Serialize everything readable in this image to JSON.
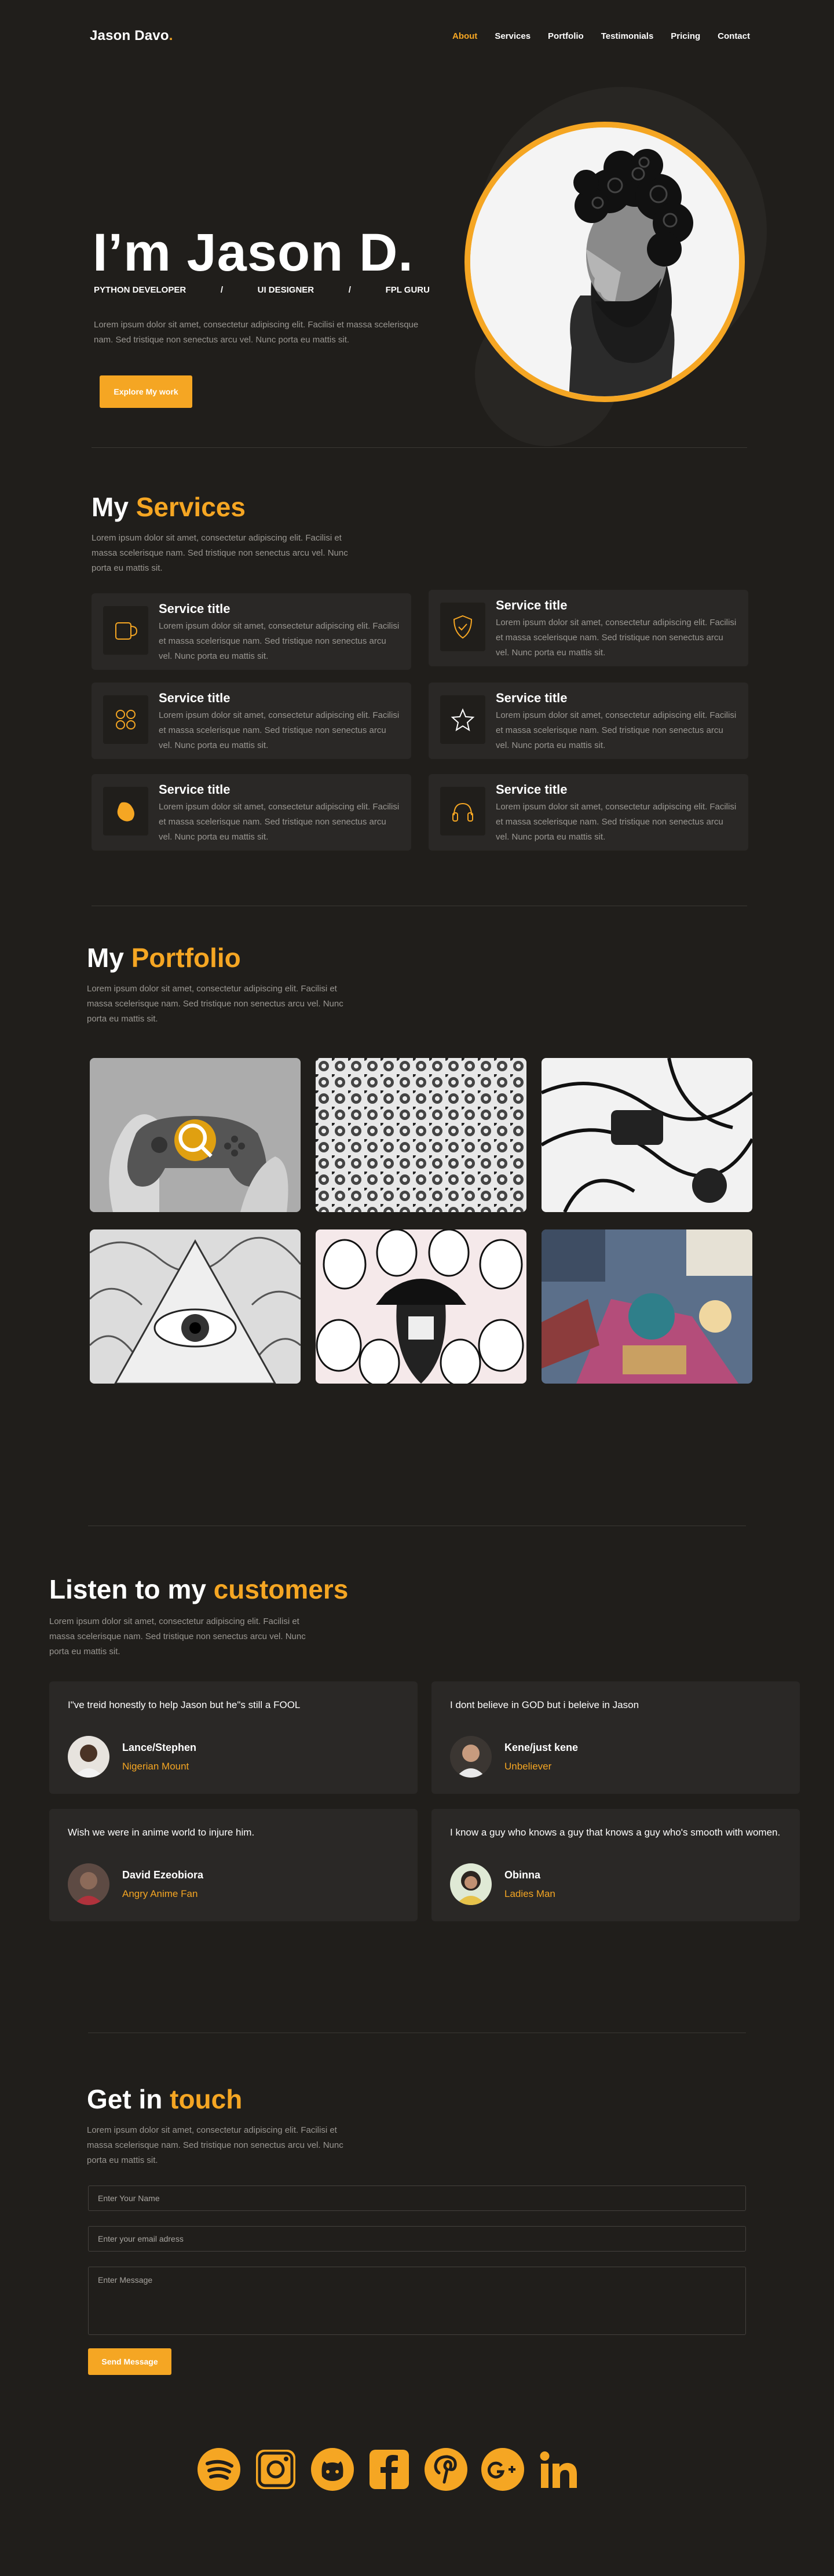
{
  "nav": {
    "brand": "Jason Davo",
    "brand_dot": ".",
    "items": [
      {
        "label": "About",
        "active": true
      },
      {
        "label": "Services",
        "active": false
      },
      {
        "label": "Portfolio",
        "active": false
      },
      {
        "label": "Testimonials",
        "active": false
      },
      {
        "label": "Pricing",
        "active": false
      },
      {
        "label": "Contact",
        "active": false
      }
    ]
  },
  "hero": {
    "title": "I’m Jason D.",
    "roles": [
      "PYTHON DEVELOPER",
      "/",
      "UI DESIGNER",
      "/",
      "FPL GURU"
    ],
    "text": "Lorem ipsum dolor sit amet, consectetur adipiscing elit. Facilisi et massa scelerisque nam. Sed tristique non senectus arcu vel. Nunc porta eu mattis sit.",
    "button": "Explore My work"
  },
  "services": {
    "title_plain": "My ",
    "title_accent": "Services",
    "text": "Lorem ipsum dolor sit amet, consectetur adipiscing elit. Facilisi et massa scelerisque nam. Sed tristique non senectus arcu vel. Nunc porta eu mattis sit.",
    "cards": [
      {
        "title": "Service title",
        "text": "Lorem ipsum dolor sit amet, consectetur adipiscing elit. Facilisi et massa scelerisque nam. Sed tristique non senectus arcu vel. Nunc porta eu mattis sit.",
        "icon": "mug-icon"
      },
      {
        "title": "Service title",
        "text": "Lorem ipsum dolor sit amet, consectetur adipiscing elit. Facilisi et massa scelerisque nam. Sed tristique non senectus arcu vel. Nunc porta eu mattis sit.",
        "icon": "shield-check-icon"
      },
      {
        "title": "Service title",
        "text": "Lorem ipsum dolor sit amet, consectetur adipiscing elit. Facilisi et massa scelerisque nam. Sed tristique non senectus arcu vel. Nunc porta eu mattis sit.",
        "icon": "grid-circles-icon"
      },
      {
        "title": "Service title",
        "text": "Lorem ipsum dolor sit amet, consectetur adipiscing elit. Facilisi et massa scelerisque nam. Sed tristique non senectus arcu vel. Nunc porta eu mattis sit.",
        "icon": "star-icon"
      },
      {
        "title": "Service title",
        "text": "Lorem ipsum dolor sit amet, consectetur adipiscing elit. Facilisi et massa scelerisque nam. Sed tristique non senectus arcu vel. Nunc porta eu mattis sit.",
        "icon": "blob-icon"
      },
      {
        "title": "Service title",
        "text": "Lorem ipsum dolor sit amet, consectetur adipiscing elit. Facilisi et massa scelerisque nam. Sed tristique non senectus arcu vel. Nunc porta eu mattis sit.",
        "icon": "headphones-icon"
      }
    ]
  },
  "portfolio": {
    "title_plain": "My ",
    "title_accent": "Portfolio",
    "text": "Lorem ipsum dolor sit amet, consectetur adipiscing elit. Facilisi et massa scelerisque nam. Sed tristique non senectus arcu vel. Nunc porta eu mattis sit."
  },
  "testimonials": {
    "title_plain": "Listen to my ",
    "title_accent": "customers",
    "text": "Lorem ipsum dolor sit amet, consectetur adipiscing elit. Facilisi et massa scelerisque nam. Sed tristique non senectus arcu vel. Nunc porta eu mattis sit.",
    "items": [
      {
        "quote": "I\"ve treid honestly to help Jason but he\"s still a FOOL",
        "name": "Lance/Stephen",
        "role": "Nigerian Mount"
      },
      {
        "quote": "I dont believe in GOD but i beleive in Jason",
        "name": "Kene/just kene",
        "role": "Unbeliever"
      },
      {
        "quote": "Wish we were in anime world to injure him.",
        "name": "David Ezeobiora",
        "role": "Angry Anime Fan"
      },
      {
        "quote": "I know a guy who knows a guy that knows a guy who's smooth with women.",
        "name": "Obinna",
        "role": "Ladies Man"
      }
    ]
  },
  "contact": {
    "title_plain": "Get in ",
    "title_accent": "touch",
    "text": "Lorem ipsum dolor sit amet, consectetur adipiscing elit. Facilisi et massa scelerisque nam. Sed tristique non senectus arcu vel. Nunc porta eu mattis sit.",
    "name_placeholder": "Enter Your Name",
    "email_placeholder": "Enter your email adress",
    "message_placeholder": "Enter Message",
    "button": "Send Message"
  },
  "socials": [
    "spotify-icon",
    "instagram-icon",
    "github-icon",
    "facebook-icon",
    "pinterest-icon",
    "google-plus-icon",
    "linkedin-icon"
  ],
  "colors": {
    "accent": "#f5a623",
    "background": "#201e1b",
    "card": "#2a2826"
  }
}
